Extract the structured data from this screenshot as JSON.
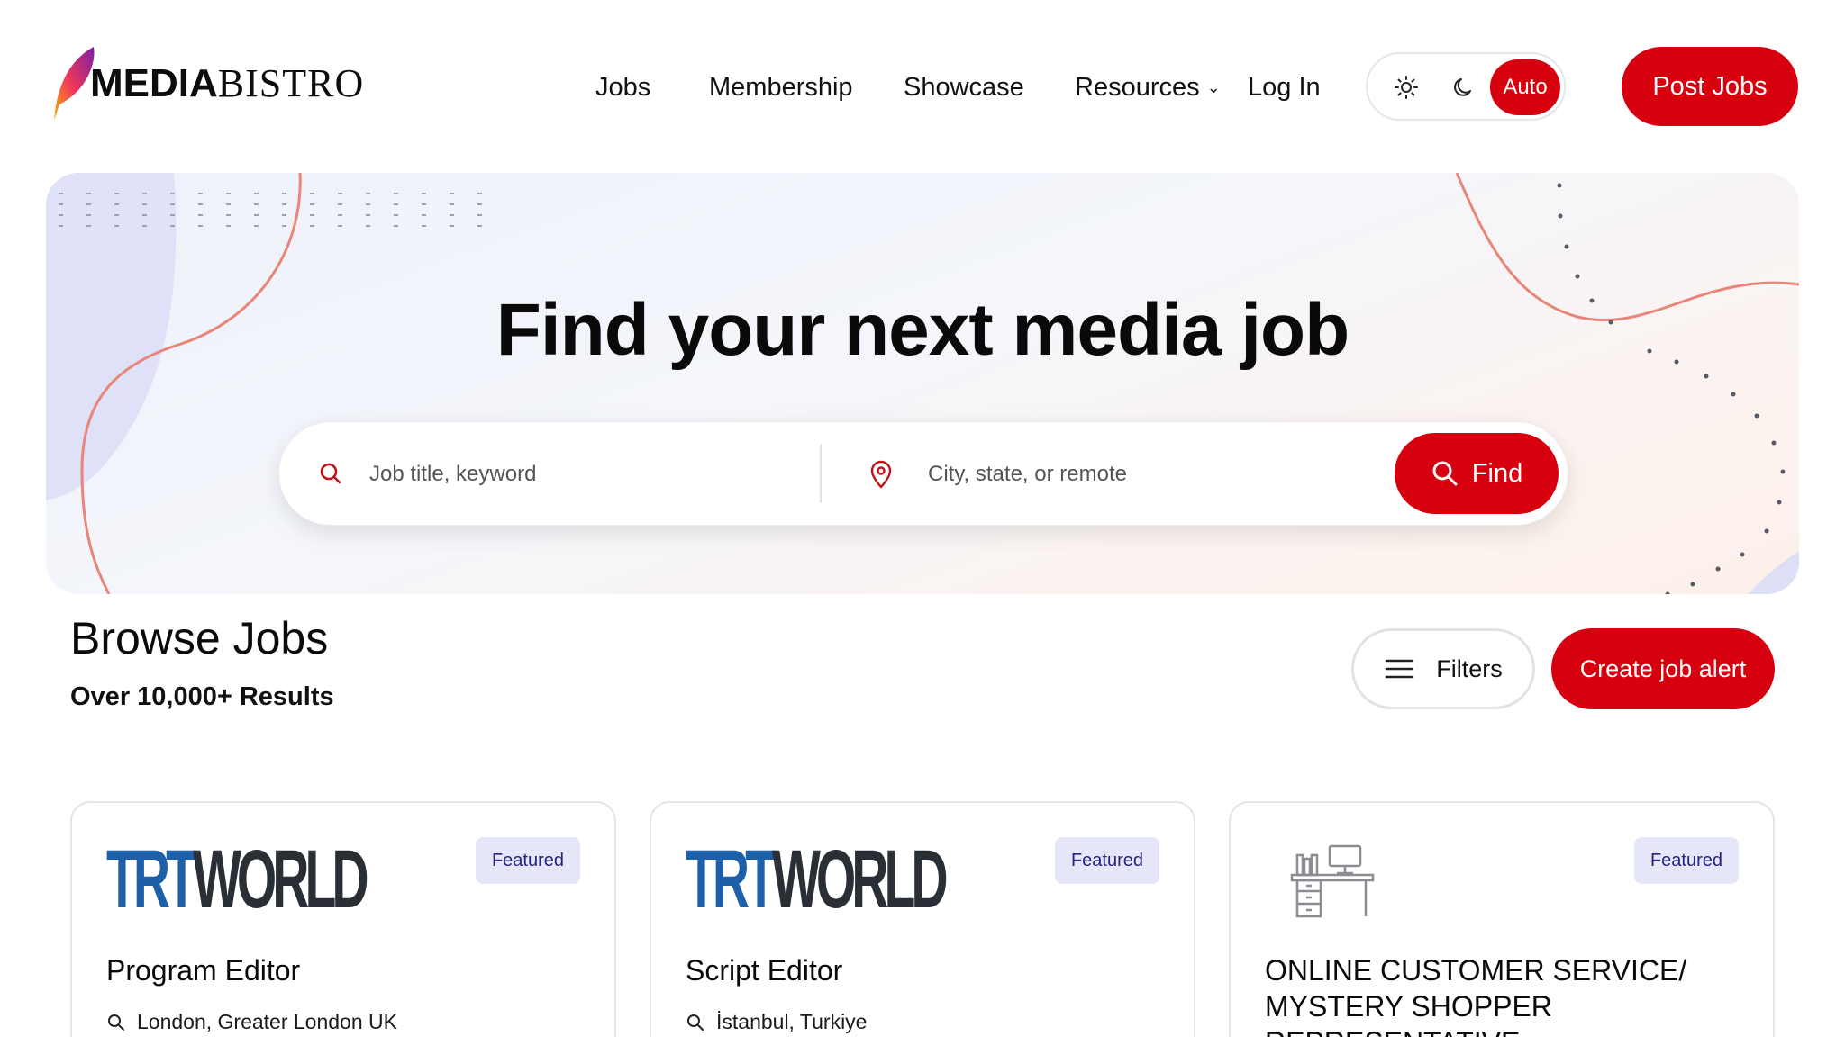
{
  "header": {
    "logo": {
      "bold": "MEDIA",
      "light": "BISTRO"
    },
    "nav": [
      {
        "label": "Jobs"
      },
      {
        "label": "Membership"
      },
      {
        "label": "Showcase"
      },
      {
        "label": "Resources",
        "has_dropdown": true
      },
      {
        "label": "Log In"
      }
    ],
    "theme_toggle": {
      "light_icon": "sun-icon",
      "dark_icon": "moon-icon",
      "auto_label": "Auto",
      "selected": "Auto"
    },
    "post_jobs_label": "Post Jobs"
  },
  "hero": {
    "title": "Find your next media job",
    "search": {
      "keyword_placeholder": "Job title, keyword",
      "location_placeholder": "City, state, or remote",
      "find_label": "Find"
    }
  },
  "browse": {
    "title": "Browse Jobs",
    "results": "Over 10,000+ Results",
    "filters_label": "Filters",
    "create_alert_label": "Create job alert"
  },
  "jobs": [
    {
      "company_logo": "TRT WORLD",
      "logo_parts": [
        "TRT",
        "WORLD"
      ],
      "badge": "Featured",
      "title": "Program Editor",
      "location": "London, Greater London UK"
    },
    {
      "company_logo": "TRT WORLD",
      "logo_parts": [
        "TRT",
        "WORLD"
      ],
      "badge": "Featured",
      "title": "Script Editor",
      "location": "İstanbul, Turkiye"
    },
    {
      "company_logo": "desk-icon",
      "badge": "Featured",
      "title": "ONLINE CUSTOMER SERVICE/ MYSTERY SHOPPER REPRESENTATIVE",
      "location": ""
    }
  ],
  "colors": {
    "brand_red": "#d6000f",
    "badge_bg": "#e6e6f9",
    "badge_text": "#252580",
    "trt_blue": "#1d5fa8"
  }
}
